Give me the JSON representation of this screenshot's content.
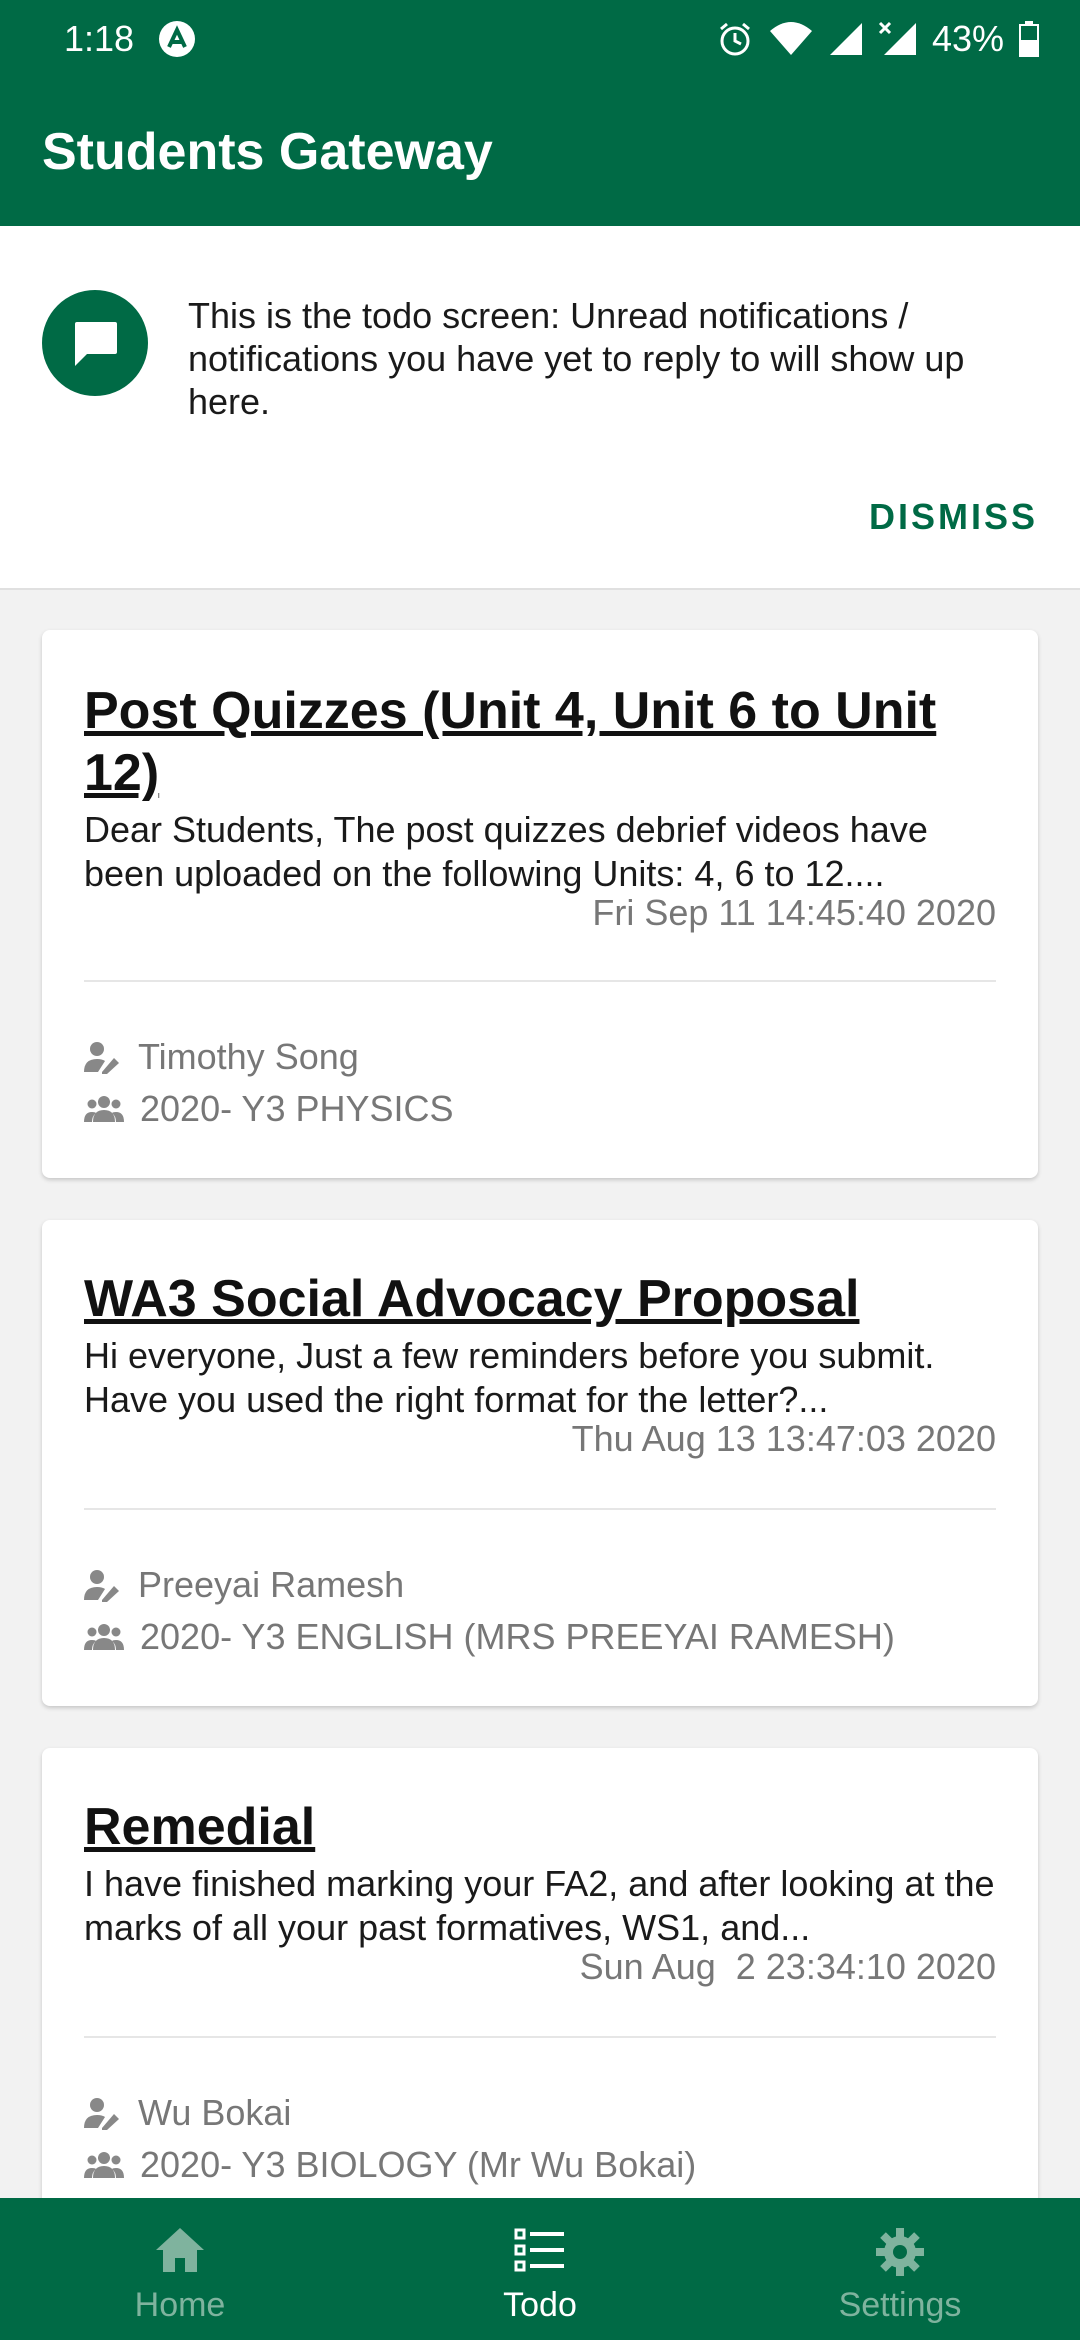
{
  "status_bar": {
    "time": "1:18",
    "battery": "43%"
  },
  "app_bar": {
    "title": "Students Gateway"
  },
  "banner": {
    "message": "This is the todo screen: Unread notifications / notifications you have yet to reply to will show up here.",
    "dismiss_label": "DISMISS"
  },
  "todos": [
    {
      "title": "Post Quizzes (Unit 4, Unit 6 to Unit 12)",
      "snippet": "Dear Students,   The post quizzes debrief videos have been uploaded on the following Units: 4, 6 to 12....",
      "date": "Fri Sep 11 14:45:40 2020",
      "author": "Timothy Song",
      "group": "2020- Y3 PHYSICS"
    },
    {
      "title": "WA3 Social Advocacy Proposal",
      "snippet": "Hi everyone,  Just a few reminders before you submit. Have you used the right format for the letter?...",
      "date": "Thu Aug 13 13:47:03 2020",
      "author": "Preeyai Ramesh",
      "group": "2020- Y3 ENGLISH (MRS PREEYAI RAMESH)"
    },
    {
      "title": "Remedial",
      "snippet": "I have finished marking your FA2, and after looking at the marks of all your past formatives, WS1, and...",
      "date": "Sun Aug  2 23:34:10 2020",
      "author": "Wu Bokai",
      "group": "2020- Y3 BIOLOGY (Mr Wu Bokai)"
    }
  ],
  "bottom_nav": {
    "items": [
      {
        "label": "Home",
        "icon": "home-icon"
      },
      {
        "label": "Todo",
        "icon": "list-icon"
      },
      {
        "label": "Settings",
        "icon": "gear-icon"
      }
    ],
    "active": "Todo"
  },
  "colors": {
    "primary": "#006a45",
    "inactive_nav": "#7fb39e"
  }
}
